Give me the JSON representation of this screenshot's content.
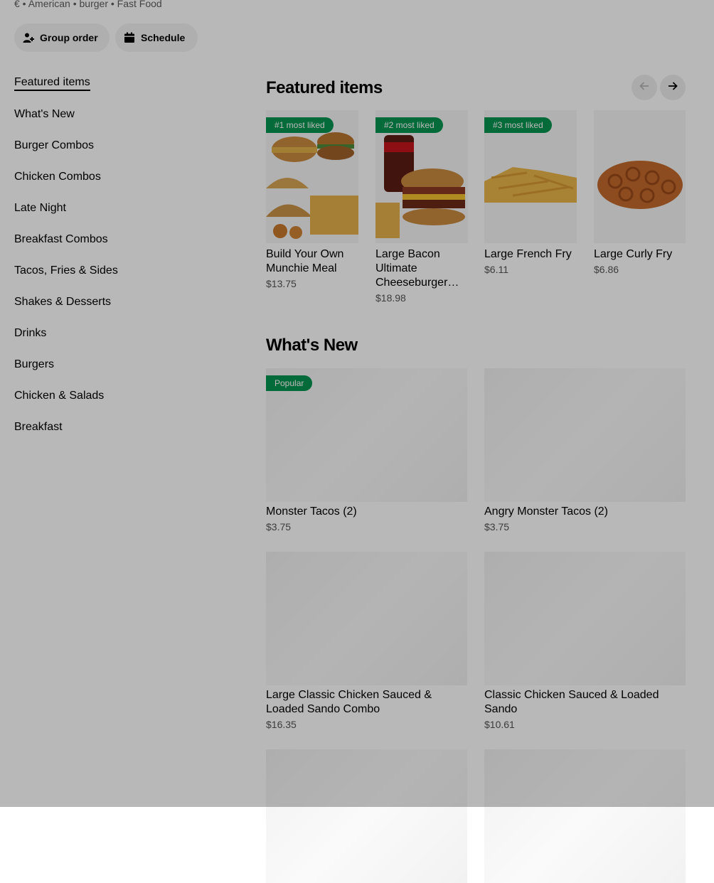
{
  "store": {
    "meta_line": "€ • American • burger • Fast Food",
    "group_order_label": "Group order",
    "schedule_label": "Schedule"
  },
  "nav": {
    "items": [
      "Featured items",
      "What's New",
      "Burger Combos",
      "Chicken Combos",
      "Late Night",
      "Breakfast Combos",
      "Tacos, Fries & Sides",
      "Shakes & Desserts",
      "Drinks",
      "Burgers",
      "Chicken & Salads",
      "Breakfast"
    ],
    "active_index": 0
  },
  "featured": {
    "title": "Featured items",
    "items": [
      {
        "badge": "#1 most liked",
        "name": "Build Your Own Munchie Meal",
        "price": "$13.75"
      },
      {
        "badge": "#2 most liked",
        "name": "Large Bacon Ultimate Cheeseburger™ Combo",
        "price": "$18.98"
      },
      {
        "badge": "#3 most liked",
        "name": "Large French Fry",
        "price": "$6.11"
      },
      {
        "badge": "",
        "name": "Large Curly Fry",
        "price": "$6.86"
      }
    ]
  },
  "whats_new": {
    "title": "What's New",
    "items": [
      {
        "badge": "Popular",
        "name": "Monster Tacos (2)",
        "price": "$3.75"
      },
      {
        "badge": "",
        "name": "Angry Monster Tacos (2)",
        "price": "$3.75"
      },
      {
        "badge": "",
        "name": "Large Classic Chicken Sauced & Loaded Sando Combo",
        "price": "$16.35"
      },
      {
        "badge": "",
        "name": "Classic Chicken Sauced & Loaded Sando",
        "price": "$10.61"
      }
    ]
  },
  "colors": {
    "badge_green": "#05944f",
    "overlay": "rgba(0,0,0,0.28)"
  },
  "icons": {
    "group_order": "person-plus-icon",
    "schedule": "calendar-icon",
    "prev": "arrow-left-icon",
    "next": "arrow-right-icon"
  }
}
